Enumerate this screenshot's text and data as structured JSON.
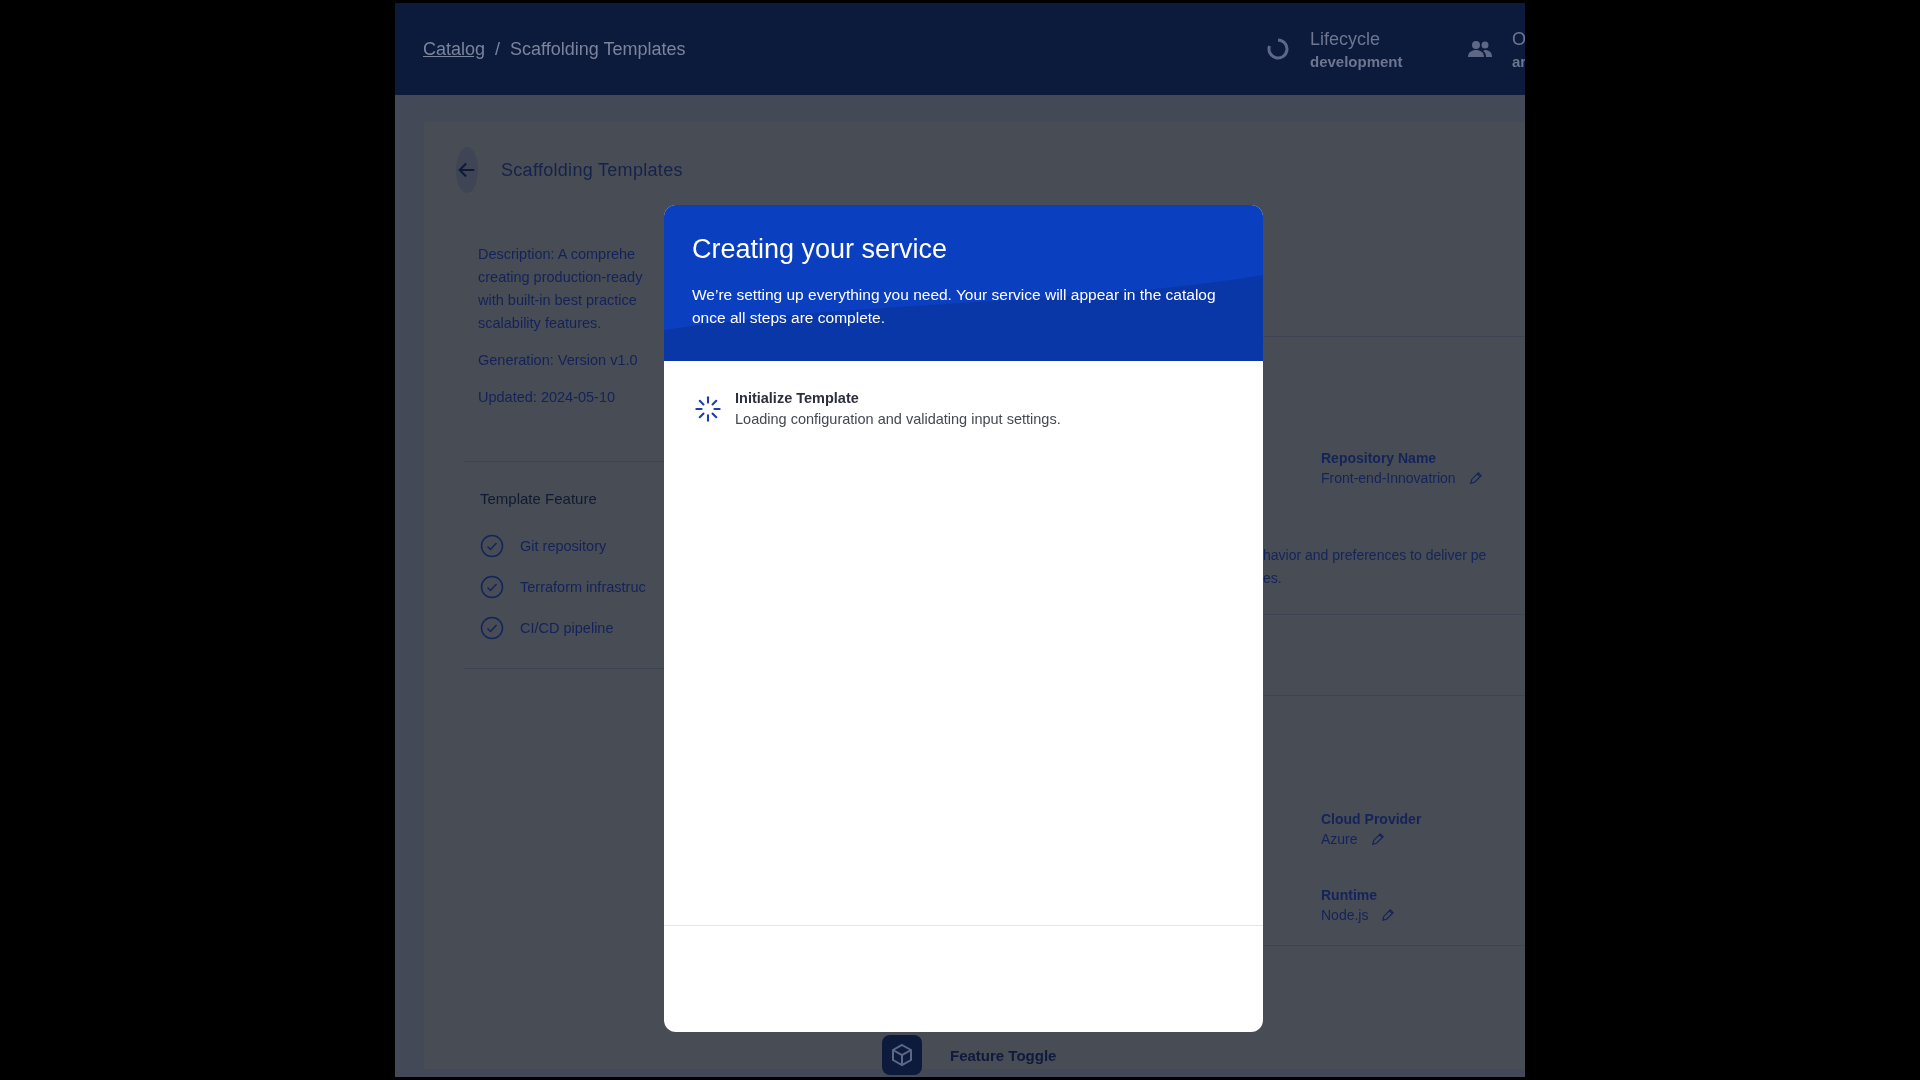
{
  "header": {
    "separator": "/",
    "breadcrumbs": [
      {
        "label": "Catalog",
        "link": true
      },
      {
        "label": "Scaffolding Templates",
        "link": false
      }
    ],
    "lifecycle": {
      "label": "Lifecycle",
      "value": "development"
    },
    "owner": {
      "label": "O",
      "value": "ar"
    }
  },
  "page": {
    "title": "Scaffolding Templates",
    "description_lines": [
      "Description: A comprehe",
      "creating production-ready",
      "with built-in best practice",
      "scalability features."
    ],
    "generation": "Generation: Version v1.0",
    "updated": "Updated: 2024-05-10",
    "features_title": "Template Feature",
    "features": [
      {
        "label": "Git repository",
        "checked": true
      },
      {
        "label": "Terraform infrastruc",
        "checked": true
      },
      {
        "label": "CI/CD pipeline",
        "checked": true
      }
    ],
    "repository": {
      "label": "Repository Name",
      "value": "Front-end-Innovatrion"
    },
    "snippet_lines": [
      "havior and preferences to deliver pe",
      "es."
    ],
    "settings": [
      {
        "label": "Cloud Provider",
        "value": "Azure"
      },
      {
        "label": "Runtime",
        "value": "Node.js"
      }
    ],
    "tile": {
      "label": "Feature Toggle"
    }
  },
  "dialog": {
    "title": "Creating your service",
    "message": "We’re setting up everything you need. Your service will appear in the catalog once all steps are complete.",
    "steps": [
      {
        "title": "Initialize Template",
        "description": "Loading configuration and validating input settings.",
        "kind": "loading"
      }
    ]
  }
}
